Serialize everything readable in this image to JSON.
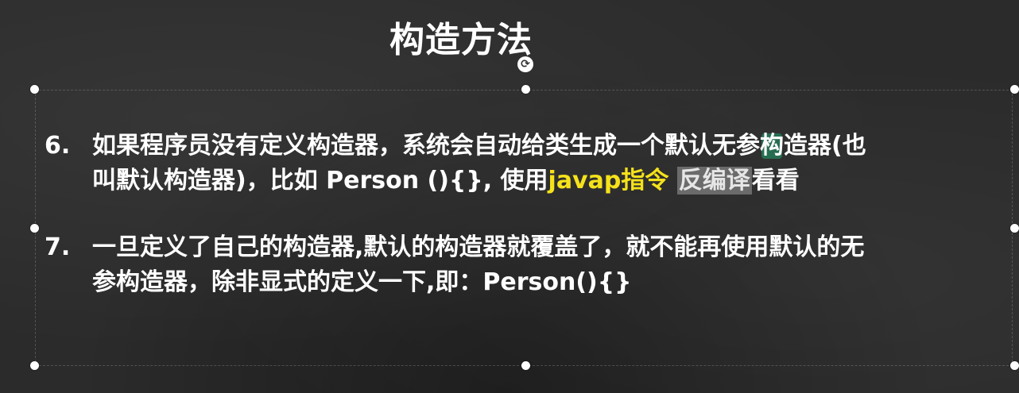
{
  "slide": {
    "title": "构造方法",
    "items": [
      {
        "number": "6.",
        "line1_before_cursor": "如果程序员没有定义构造器，系统会自动给类生成一个默认无参",
        "line1_cursor_char": "构",
        "line1_after_cursor": "造器(也",
        "line2_plain": "叫默认构造器)，比如 Person (){}, 使用",
        "line2_yellow": "javap指令",
        "line2_gray": "反编译",
        "line2_end": "看看"
      },
      {
        "number": "7.",
        "line1": "一旦定义了自己的构造器,默认的构造器就覆盖了，就不能再使用默认的无",
        "line2": "参构造器，除非显式的定义一下,即：Person(){}"
      }
    ]
  },
  "icons": {
    "rotate_handle": "rotate-icon"
  },
  "colors": {
    "background": "#2b2b2b",
    "text": "#ffffff",
    "highlight_yellow": "#f5e21a",
    "highlight_gray": "#6b6b6b",
    "cursor_green": "#20a06e"
  }
}
